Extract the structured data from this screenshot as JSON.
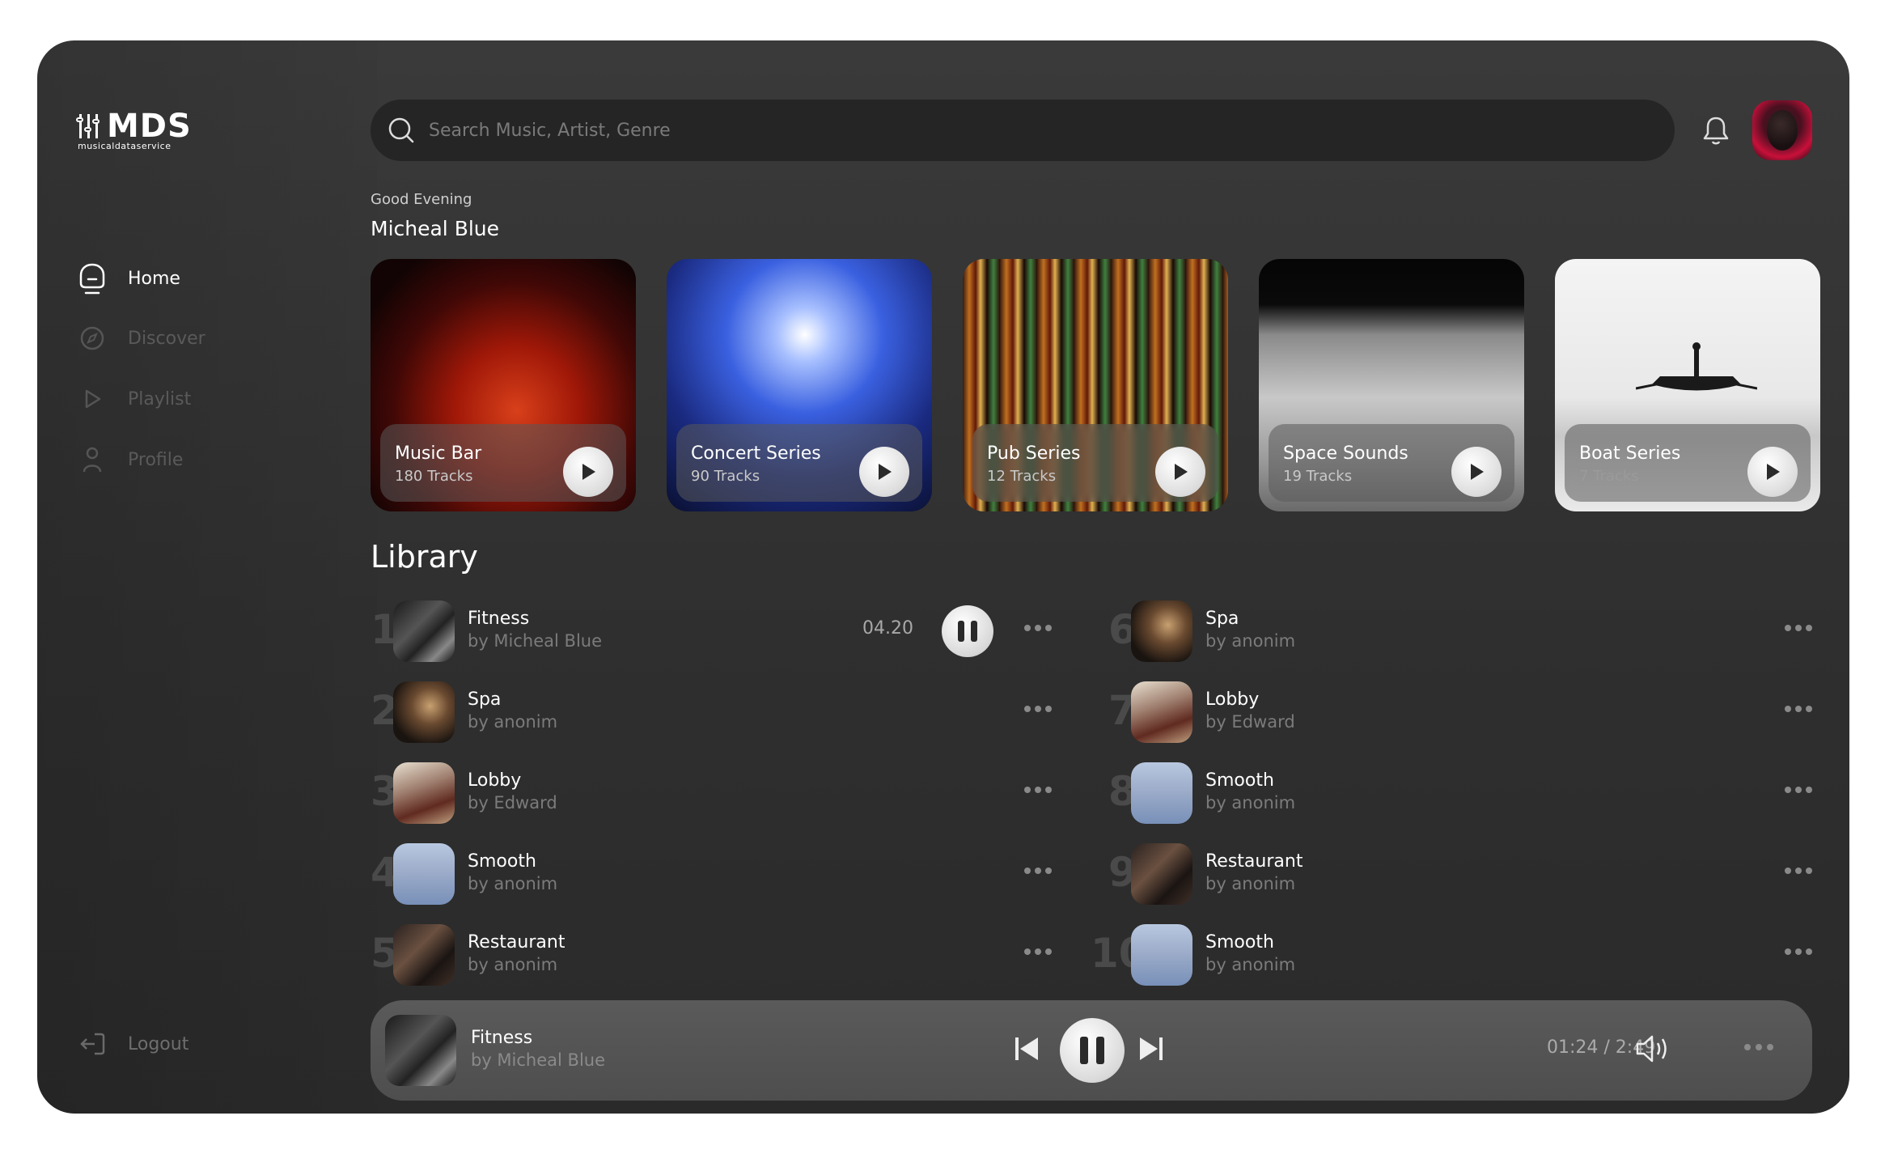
{
  "brand": {
    "name": "MDS",
    "subtitle": "musicaldataservice"
  },
  "sidebar": {
    "items": [
      {
        "label": "Home",
        "icon": "home-icon",
        "active": true
      },
      {
        "label": "Discover",
        "icon": "compass-icon",
        "active": false
      },
      {
        "label": "Playlist",
        "icon": "play-icon",
        "active": false
      },
      {
        "label": "Profile",
        "icon": "user-icon",
        "active": false
      }
    ],
    "logout": {
      "label": "Logout",
      "icon": "logout-icon"
    }
  },
  "search": {
    "placeholder": "Search Music, Artist, Genre",
    "value": ""
  },
  "header": {
    "greeting": "Good Evening",
    "user_name": "Micheal Blue"
  },
  "cards": [
    {
      "title": "Music Bar",
      "tracks": "180 Tracks"
    },
    {
      "title": "Concert Series",
      "tracks": "90 Tracks"
    },
    {
      "title": "Pub Series",
      "tracks": "12 Tracks"
    },
    {
      "title": "Space Sounds",
      "tracks": "19 Tracks"
    },
    {
      "title": "Boat Series",
      "tracks": "7 Tracks"
    }
  ],
  "library": {
    "title": "Library",
    "tracks": [
      {
        "num": "1",
        "title": "Fitness",
        "artist": "by Micheal Blue",
        "duration": "04.20",
        "playing": true
      },
      {
        "num": "2",
        "title": "Spa",
        "artist": "by anonim"
      },
      {
        "num": "3",
        "title": "Lobby",
        "artist": "by Edward"
      },
      {
        "num": "4",
        "title": "Smooth",
        "artist": "by anonim"
      },
      {
        "num": "5",
        "title": "Restaurant",
        "artist": "by anonim"
      },
      {
        "num": "6",
        "title": "Spa",
        "artist": "by anonim"
      },
      {
        "num": "7",
        "title": "Lobby",
        "artist": "by Edward"
      },
      {
        "num": "8",
        "title": "Smooth",
        "artist": "by anonim"
      },
      {
        "num": "9",
        "title": "Restaurant",
        "artist": "by anonim"
      },
      {
        "num": "10",
        "title": "Smooth",
        "artist": "by anonim"
      }
    ]
  },
  "player": {
    "title": "Fitness",
    "artist": "by Micheal Blue",
    "time": "01:24 / 2:49"
  },
  "colors": {
    "background": "#333333",
    "accent": "#ffffff",
    "muted": "#7b7b7b"
  }
}
